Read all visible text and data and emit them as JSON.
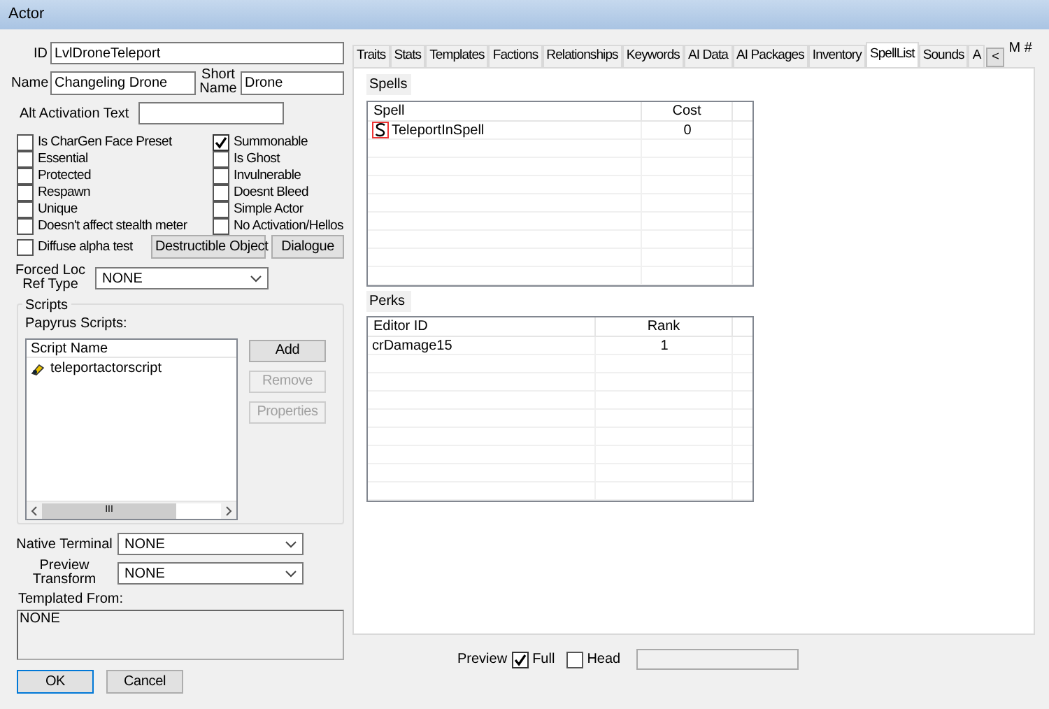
{
  "window": {
    "title": "Actor"
  },
  "id_field": {
    "label": "ID",
    "value": "LvlDroneTeleport"
  },
  "name_field": {
    "label": "Name",
    "value": "Changeling Drone"
  },
  "short_name_field": {
    "label": "Short Name",
    "value": "Drone"
  },
  "alt_activation": {
    "label": "Alt Activation Text"
  },
  "flags_left": [
    {
      "label": "Is CharGen Face Preset",
      "checked": false
    },
    {
      "label": "Essential",
      "checked": false
    },
    {
      "label": "Protected",
      "checked": false
    },
    {
      "label": "Respawn",
      "checked": false
    },
    {
      "label": "Unique",
      "checked": false
    },
    {
      "label": "Doesn't affect stealth meter",
      "checked": false
    },
    {
      "label": "Diffuse alpha test",
      "checked": false
    }
  ],
  "flags_right": [
    {
      "label": "Summonable",
      "checked": true
    },
    {
      "label": "Is Ghost",
      "checked": false
    },
    {
      "label": "Invulnerable",
      "checked": false
    },
    {
      "label": "Doesnt Bleed",
      "checked": false
    },
    {
      "label": "Simple Actor",
      "checked": false
    },
    {
      "label": "No Activation/Hellos",
      "checked": false
    }
  ],
  "flag_buttons": [
    "Destructible Object",
    "Dialogue"
  ],
  "forced_loc": {
    "label": "Forced Loc Ref Type",
    "value": "NONE"
  },
  "scripts": {
    "group": "Scripts",
    "label": "Papyrus Scripts:",
    "column": "Script Name",
    "items": [
      "teleportactorscript"
    ],
    "buttons": [
      {
        "label": "Add",
        "disabled": false
      },
      {
        "label": "Remove",
        "disabled": true
      },
      {
        "label": "Properties",
        "disabled": true
      }
    ],
    "scroll_glyph": "III"
  },
  "native_terminal": {
    "label": "Native Terminal",
    "value": "NONE"
  },
  "preview_transform": {
    "label": "Preview Transform",
    "value": "NONE"
  },
  "templated_from": {
    "label": "Templated From:",
    "value": "NONE"
  },
  "dialog_buttons": [
    "OK",
    "Cancel"
  ],
  "tabs": [
    {
      "label": "Traits",
      "selected": false
    },
    {
      "label": "Stats",
      "selected": false
    },
    {
      "label": "Templates",
      "selected": false
    },
    {
      "label": "Factions",
      "selected": false
    },
    {
      "label": "Relationships",
      "selected": false
    },
    {
      "label": "Keywords",
      "selected": false
    },
    {
      "label": "AI Data",
      "selected": false
    },
    {
      "label": "AI Packages",
      "selected": false
    },
    {
      "label": "Inventory",
      "selected": false
    },
    {
      "label": "SpellList",
      "selected": true
    },
    {
      "label": "Sounds",
      "selected": false
    },
    {
      "label": "A",
      "selected": false
    }
  ],
  "tab_scroll": "<",
  "background_text": "M #",
  "spells": {
    "label": "Spells",
    "columns": [
      "Spell",
      "Cost"
    ],
    "rows": [
      {
        "spell": "TeleportInSpell",
        "cost": "0"
      }
    ]
  },
  "perks": {
    "label": "Perks",
    "columns": [
      "Editor ID",
      "Rank"
    ],
    "rows": [
      {
        "editor_id": "crDamage15",
        "rank": "1"
      }
    ]
  },
  "preview": {
    "label": "Preview",
    "options": [
      {
        "label": "Full",
        "checked": true
      },
      {
        "label": "Head",
        "checked": false
      }
    ]
  }
}
